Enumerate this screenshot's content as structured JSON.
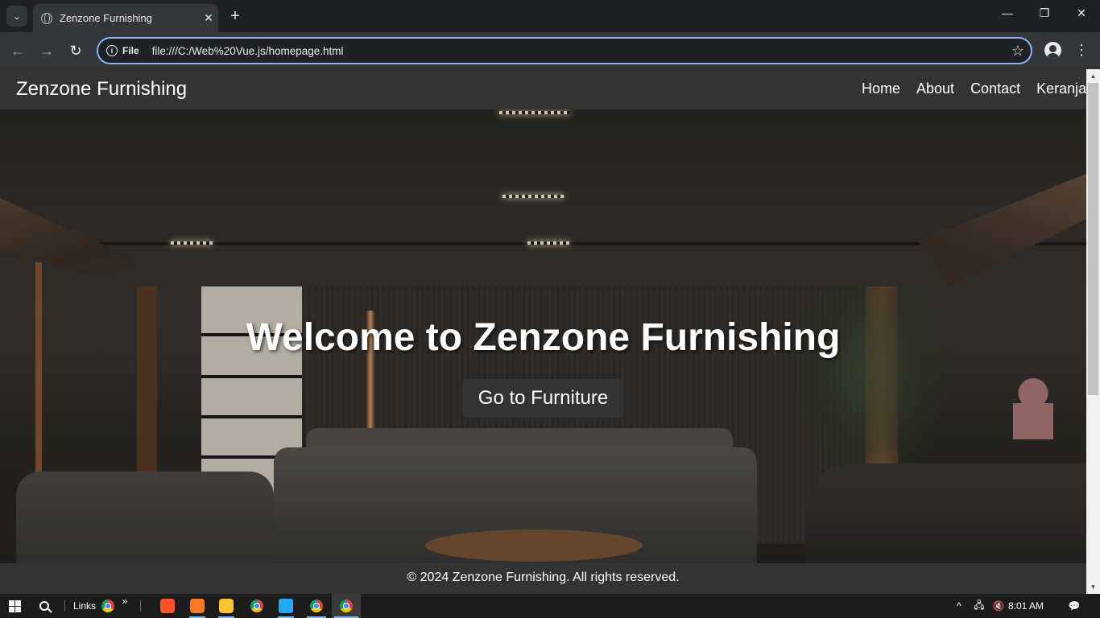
{
  "browser": {
    "tab_title": "Zenzone Furnishing",
    "tab_close": "✕",
    "new_tab": "+",
    "omnibox_chip": "File",
    "url": "file:///C:/Web%20Vue.js/homepage.html",
    "window_controls": {
      "minimize": "—",
      "maximize": "❐",
      "close": "✕"
    },
    "nav": {
      "back": "←",
      "forward": "→",
      "reload": "↻",
      "star": "☆",
      "menu": "⋮",
      "tab_menu": "⌄"
    }
  },
  "site": {
    "brand": "Zenzone Furnishing",
    "menu": [
      {
        "label": "Home"
      },
      {
        "label": "About"
      },
      {
        "label": "Contact"
      },
      {
        "label": "Keranjang"
      }
    ],
    "hero": {
      "title": "Welcome to Zenzone Furnishing",
      "button": "Go to Furniture"
    },
    "footer": "© 2024 Zenzone Furnishing. All rights reserved."
  },
  "taskbar": {
    "links_label": "Links",
    "more": "»",
    "clock": "8:01 AM",
    "tray": {
      "chevron": "^",
      "network": "🖧",
      "volume": "🔇",
      "notifications": "💬"
    }
  },
  "colors": {
    "nav_bg": "#333333",
    "omnibox_focus": "#8ab4f8",
    "chrome_bg": "#202124",
    "toolbar_bg": "#35363a"
  }
}
